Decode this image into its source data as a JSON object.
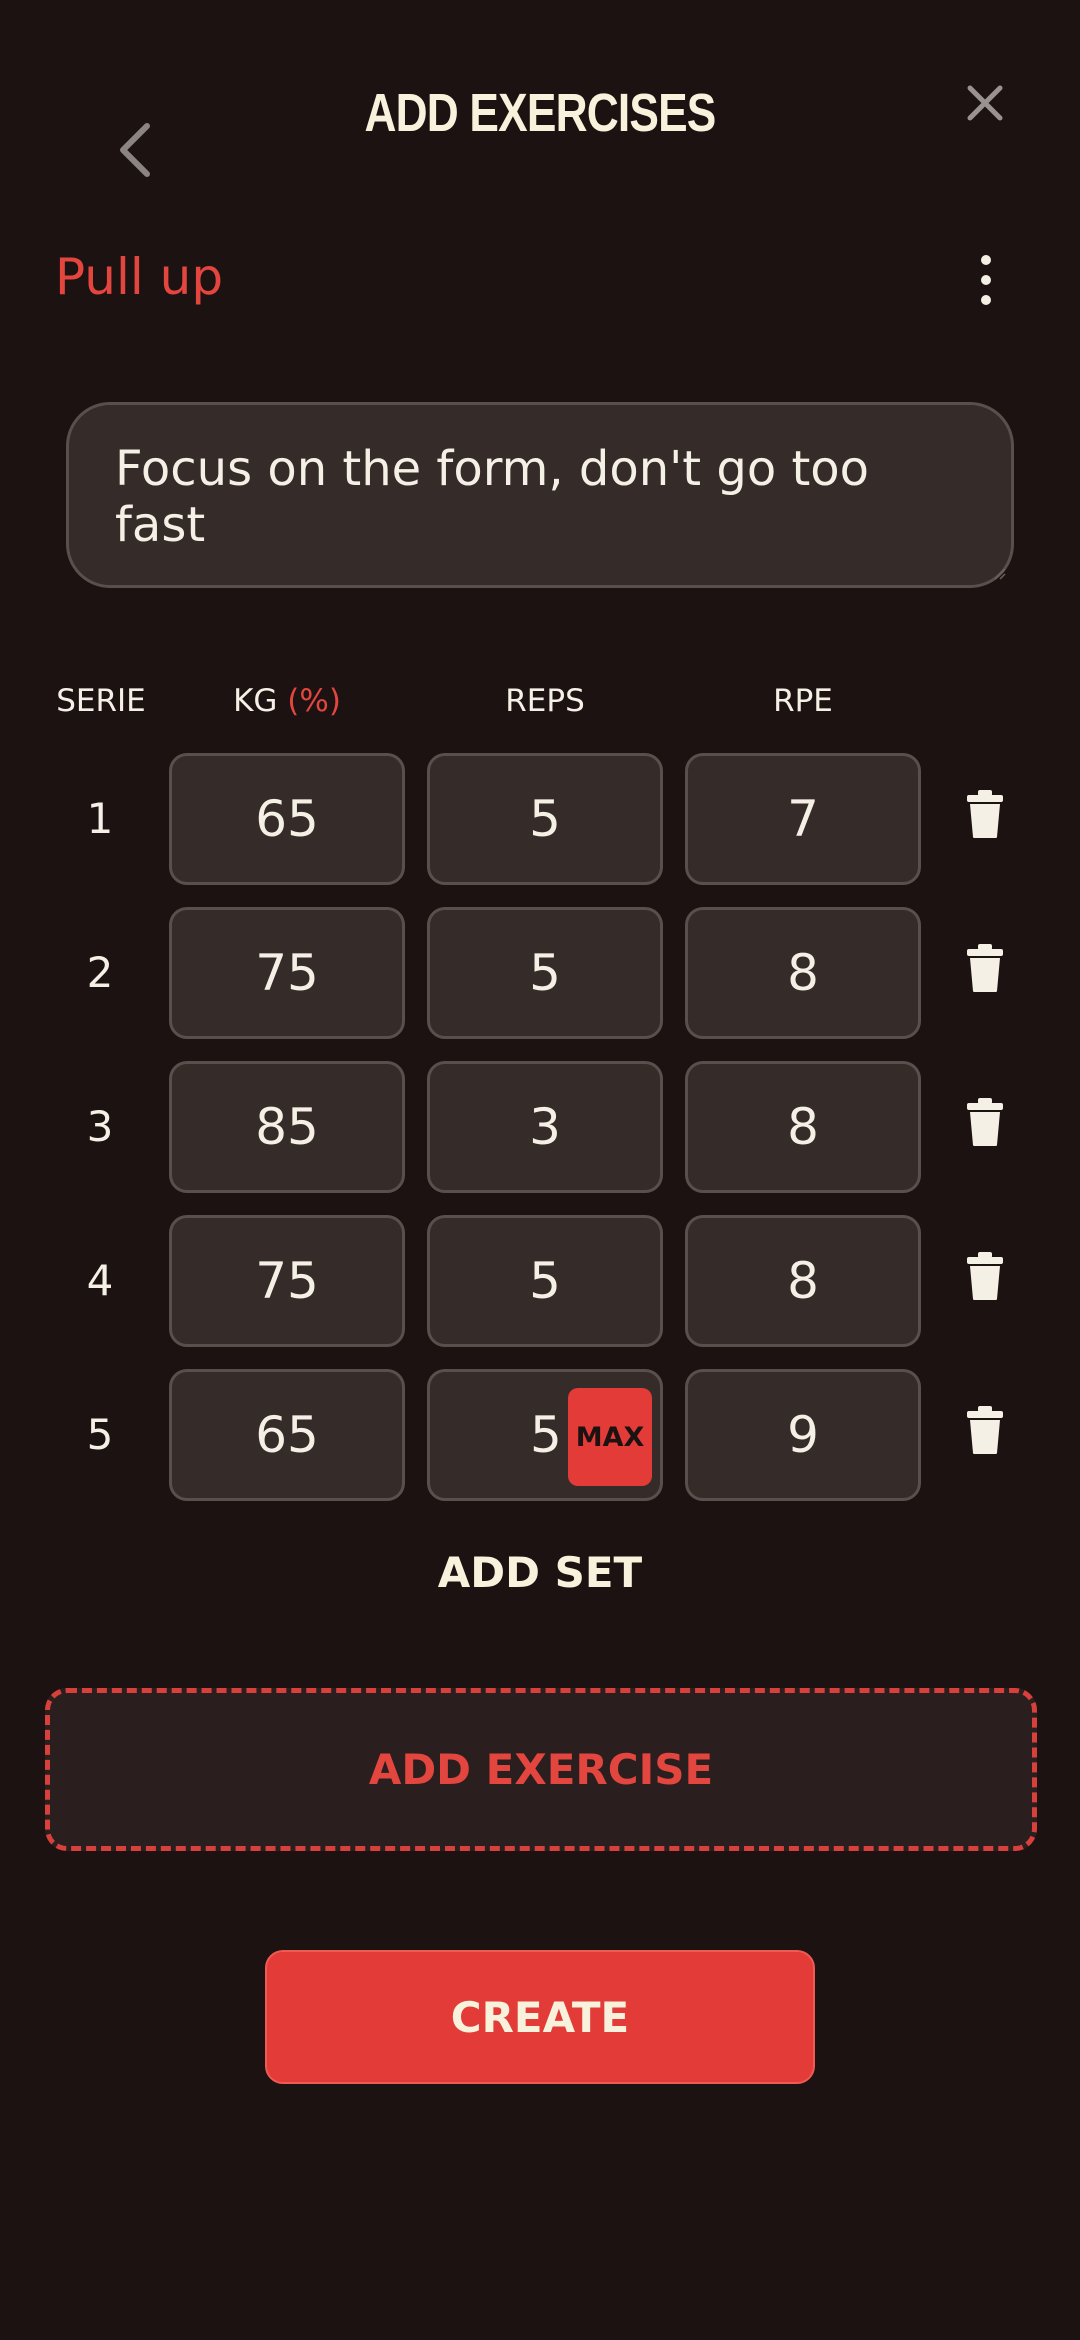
{
  "header": {
    "title": "ADD EXERCISES",
    "back_icon": "chevron-left-icon",
    "close_icon": "close-icon"
  },
  "exercise": {
    "name": "Pull up",
    "more_icon": "more-vertical-icon",
    "note": "Focus on the form, don't go too fast"
  },
  "table": {
    "headers": {
      "serie": "SERIE",
      "kg": "KG",
      "kg_pct": "(%)",
      "reps": "REPS",
      "rpe": "RPE"
    },
    "rows": [
      {
        "serie": "1",
        "kg": "65",
        "reps": "5",
        "rpe": "7"
      },
      {
        "serie": "2",
        "kg": "75",
        "reps": "5",
        "rpe": "8"
      },
      {
        "serie": "3",
        "kg": "85",
        "reps": "3",
        "rpe": "8"
      },
      {
        "serie": "4",
        "kg": "75",
        "reps": "5",
        "rpe": "8"
      },
      {
        "serie": "5",
        "kg": "65",
        "reps": "5",
        "rpe": "9",
        "badge": "MAX"
      }
    ]
  },
  "actions": {
    "add_set": "ADD SET",
    "add_exercise": "ADD EXERCISE",
    "create": "CREATE"
  },
  "colors": {
    "background": "#1c1212",
    "accent": "#e23b38",
    "field": "#352b29",
    "text": "#f5f0e6"
  }
}
